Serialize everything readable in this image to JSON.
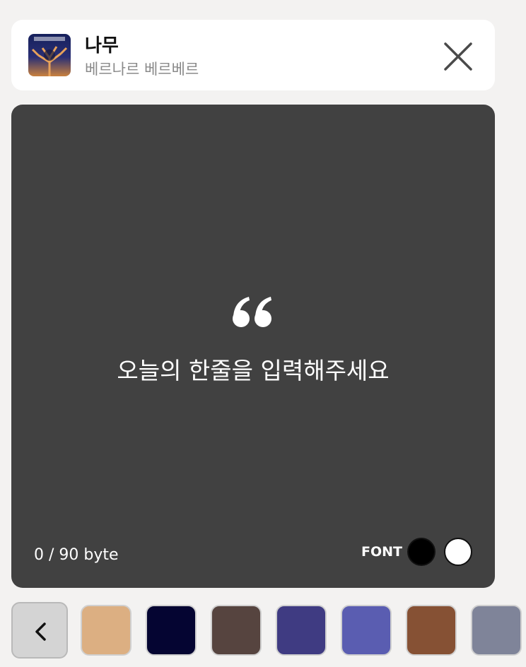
{
  "header": {
    "cover_icon": "book-cover-image",
    "title": "나무",
    "author": "베르나르 베르베르",
    "close_icon": "close-icon"
  },
  "quote": {
    "quote_mark_icon": "opening-quote-icon",
    "placeholder": "오늘의 한줄을 입력해주세요",
    "byte_counter": "0 / 90 byte",
    "background_color": "#414141",
    "font_label": "FONT",
    "font_colors": [
      "#000000",
      "#ffffff"
    ]
  },
  "palette": {
    "back_icon": "chevron-left-icon",
    "colors": [
      "#dcaf82",
      "#050532",
      "#56443f",
      "#3f3b82",
      "#5a5db1",
      "#865134",
      "#7f8499"
    ]
  }
}
